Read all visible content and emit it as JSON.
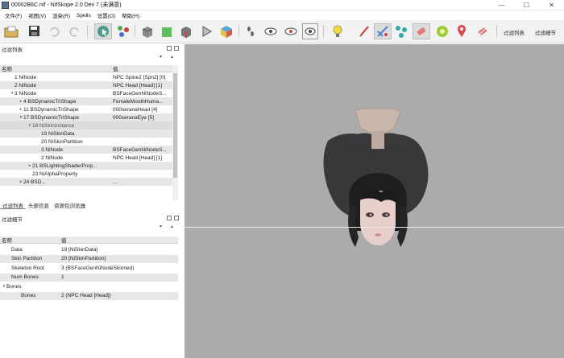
{
  "window": {
    "title": "00002B6C.nif - NifSkope 2.0 Dev 7 (未满意)",
    "controls": [
      "—",
      "☐",
      "✕"
    ]
  },
  "menu": [
    "文件(F)",
    "视图(V)",
    "渲染(R)",
    "Spells",
    "设置(O)",
    "帮助(H)"
  ],
  "toolbar": {
    "filter_list_label": "过滤列表",
    "filter_detail_label": "过滤细节"
  },
  "tree_panel": {
    "title": "过滤列表",
    "columns": [
      "名称",
      "值"
    ],
    "rows": [
      {
        "indent": 0,
        "arrow": "",
        "name": "1 NiNode",
        "value": "NPC Spine2 [Spn2] [0]"
      },
      {
        "indent": 0,
        "arrow": "",
        "name": "2 NiNode",
        "value": "NPC Head [Head] [1]"
      },
      {
        "indent": 0,
        "arrow": "▾",
        "name": "3 NiNode",
        "value": "BSFaceGenNiNodeS..."
      },
      {
        "indent": 1,
        "arrow": "▸",
        "name": "4 BSDynamicTriShape",
        "value": "FemaleMouthHuma..."
      },
      {
        "indent": 1,
        "arrow": "▸",
        "name": "11 BSDynamicTriShape",
        "value": "000seranaHead [4]"
      },
      {
        "indent": 1,
        "arrow": "▾",
        "name": "17 BSDynamicTriShape",
        "value": "000seranaEye [5]"
      },
      {
        "indent": 2,
        "arrow": "▾",
        "name": "18 NiSkinInstance",
        "value": ""
      },
      {
        "indent": 3,
        "arrow": "",
        "name": "19 NiSkinData",
        "value": ""
      },
      {
        "indent": 3,
        "arrow": "",
        "name": "20 NiSkinPartition",
        "value": ""
      },
      {
        "indent": 3,
        "arrow": "",
        "name": "3 NiNode",
        "value": "BSFaceGenNiNodeS..."
      },
      {
        "indent": 3,
        "arrow": "",
        "name": "2 NiNode",
        "value": "NPC Head [Head] [1]"
      },
      {
        "indent": 2,
        "arrow": "▸",
        "name": "21 BSLightingShaderProp...",
        "value": ""
      },
      {
        "indent": 2,
        "arrow": "",
        "name": "23 NiAlphaProperty",
        "value": ""
      },
      {
        "indent": 1,
        "arrow": "▸",
        "name": "24 BSD...",
        "value": "..."
      }
    ],
    "selected_row": 6
  },
  "bottom_tabs": [
    "过滤列表",
    "头部信息",
    "资源包浏览器"
  ],
  "detail_panel": {
    "title": "过滤细节",
    "columns": [
      "名称",
      "值"
    ],
    "rows": [
      {
        "indent": 0,
        "arrow": "",
        "name": "Data",
        "value": "19 [NiSkinData]"
      },
      {
        "indent": 0,
        "arrow": "",
        "name": "Skin Partition",
        "value": "20 [NiSkinPartition]"
      },
      {
        "indent": 0,
        "arrow": "",
        "name": "Skeleton Root",
        "value": "3 (BSFaceGenNiNodeSkinned)"
      },
      {
        "indent": 0,
        "arrow": "",
        "name": "Num Bones",
        "value": "1"
      },
      {
        "indent": 0,
        "arrow": "▾",
        "name": "Bones",
        "value": ""
      },
      {
        "indent": 1,
        "arrow": "",
        "name": "Bones",
        "value": "2 (NPC Head [Head])"
      }
    ]
  },
  "colors": {
    "viewport_bg": "#ababab",
    "hair": "#2c2c2c",
    "skin": "#e8cfcb",
    "headgear": "#c8b6ab"
  }
}
